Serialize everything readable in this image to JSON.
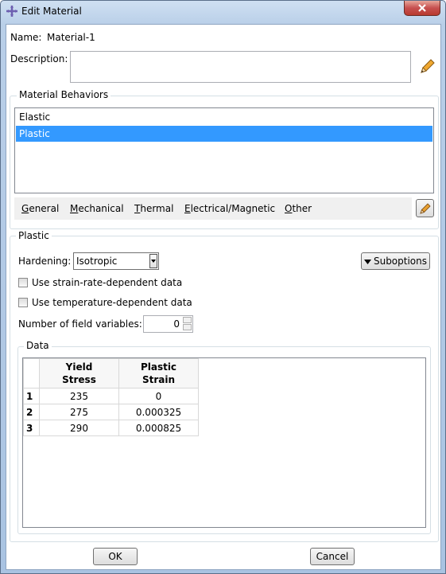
{
  "window": {
    "title": "Edit Material"
  },
  "name": {
    "label": "Name:",
    "value": "Material-1"
  },
  "description": {
    "label": "Description:",
    "value": ""
  },
  "behaviors": {
    "group_title": "Material Behaviors",
    "items": [
      "Elastic",
      "Plastic"
    ],
    "selected": "Plastic"
  },
  "menus": [
    {
      "accel": "G",
      "rest": "eneral"
    },
    {
      "accel": "M",
      "rest": "echanical"
    },
    {
      "accel": "T",
      "rest": "hermal"
    },
    {
      "accel": "E",
      "rest": "lectrical/Magnetic"
    },
    {
      "accel": "O",
      "rest": "ther"
    }
  ],
  "plastic": {
    "group_title": "Plastic",
    "hardening_label": "Hardening:",
    "hardening_value": "Isotropic",
    "suboptions_label": "Suboptions",
    "strain_rate_label": "Use strain-rate-dependent data",
    "temperature_label": "Use temperature-dependent data",
    "field_vars_label": "Number of field variables:",
    "field_vars_value": "0"
  },
  "data_table": {
    "group_title": "Data",
    "columns": [
      {
        "line1": "Yield",
        "line2": "Stress"
      },
      {
        "line1": "Plastic",
        "line2": "Strain"
      }
    ],
    "rows": [
      {
        "index": "1",
        "yield_stress": "235",
        "plastic_strain": "0"
      },
      {
        "index": "2",
        "yield_stress": "275",
        "plastic_strain": "0.000325"
      },
      {
        "index": "3",
        "yield_stress": "290",
        "plastic_strain": "0.000825"
      }
    ]
  },
  "footer": {
    "ok_label": "OK",
    "cancel_label": "Cancel"
  },
  "colors": {
    "selection": "#3399ff",
    "close_button": "#c75050"
  }
}
